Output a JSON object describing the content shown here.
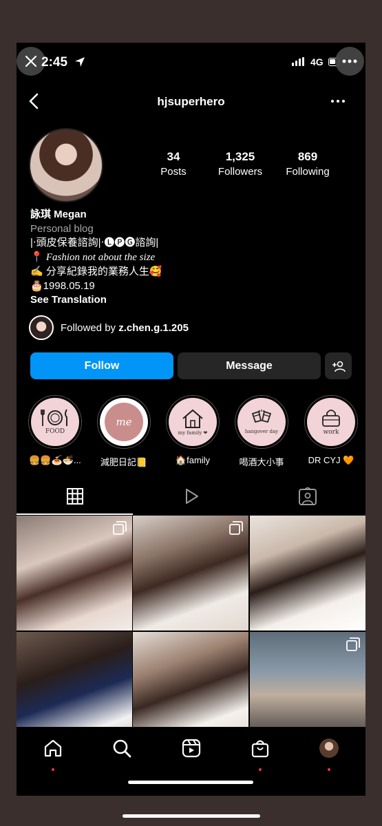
{
  "status_bar": {
    "time": "2:45",
    "network": "4G"
  },
  "header": {
    "username": "hjsuperhero"
  },
  "profile": {
    "stats": [
      {
        "num": "34",
        "label": "Posts"
      },
      {
        "num": "1,325",
        "label": "Followers"
      },
      {
        "num": "869",
        "label": "Following"
      }
    ],
    "bio": {
      "name": "詠琪 Megan",
      "category": "Personal blog",
      "line1": "|‧頭皮保養諮詢|‧🅛🅟🅖諮詢|",
      "line2_pin": "📍",
      "line2_text": "Fashion not about the size",
      "line3": "✍️ 分享紀錄我的業務人生🥰",
      "line4": "🎂1998.05.19",
      "see_translation": "See Translation"
    },
    "followed_by_prefix": "Followed by ",
    "followed_by_user": "z.chen.g.1.205"
  },
  "buttons": {
    "follow": "Follow",
    "message": "Message"
  },
  "highlights": [
    {
      "caption": "🍔🍔🍝🍜...",
      "inner": "FOOD"
    },
    {
      "caption": "減肥日記📒",
      "inner": "me"
    },
    {
      "caption": "🏠family",
      "inner": "my family ❤"
    },
    {
      "caption": "喝酒大小事",
      "inner": "hangover day"
    },
    {
      "caption": "DR CYJ 🧡",
      "inner": "work"
    }
  ],
  "colors": {
    "accent": "#0095f6",
    "highlight_bg": "#f2d3d8",
    "notification": "#ff3040"
  }
}
